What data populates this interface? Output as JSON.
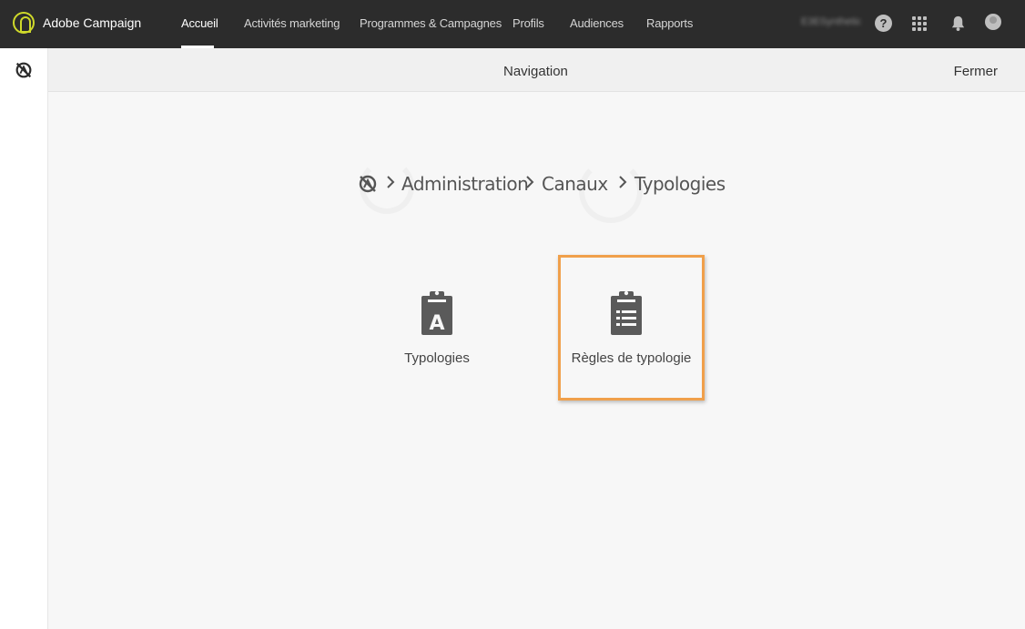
{
  "topbar": {
    "app_title": "Adobe Campaign",
    "nav": [
      {
        "label": "Accueil",
        "active": true
      },
      {
        "label": "Activités marketing",
        "active": false
      },
      {
        "label": "Programmes & Campagnes",
        "active": false
      },
      {
        "label": "Profils",
        "active": false
      },
      {
        "label": "Audiences",
        "active": false
      },
      {
        "label": "Rapports",
        "active": false
      }
    ],
    "user_name": "E3ESynthetic",
    "help_icon": "?",
    "accent_color": "#cfd92a"
  },
  "nav_panel": {
    "title": "Navigation",
    "close_label": "Fermer"
  },
  "breadcrumb": {
    "items": [
      "Administration",
      "Canaux",
      "Typologies"
    ]
  },
  "tiles": [
    {
      "label": "Typologies",
      "icon": "clipboard-a-icon",
      "selected": false
    },
    {
      "label": "Règles de typologie",
      "icon": "clipboard-list-icon",
      "selected": true
    }
  ],
  "colors": {
    "topbar_bg": "#2c2c2c",
    "highlight": "#f0a04b"
  }
}
